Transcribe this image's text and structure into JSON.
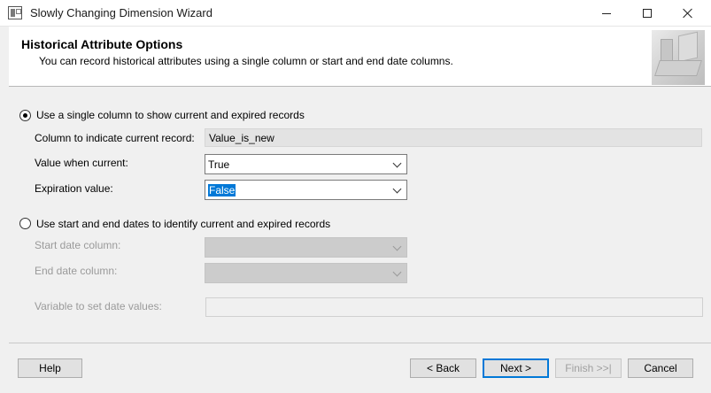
{
  "window": {
    "title": "Slowly Changing Dimension Wizard"
  },
  "header": {
    "title": "Historical Attribute Options",
    "subtitle": "You can record historical attributes using a single column or start and end date columns."
  },
  "option_single_column": {
    "label": "Use a single column to show current and expired records",
    "selected": true,
    "column_label": "Column to indicate current record:",
    "column_value": "Value_is_new",
    "current_label": "Value when current:",
    "current_value": "True",
    "expiration_label": "Expiration value:",
    "expiration_value": "False"
  },
  "option_date_range": {
    "label": "Use start and end dates to identify current and expired records",
    "selected": false,
    "start_label": "Start date column:",
    "start_value": "",
    "end_label": "End date column:",
    "end_value": "",
    "variable_label": "Variable to set date values:",
    "variable_value": ""
  },
  "buttons": {
    "help": "Help",
    "back": "< Back",
    "next": "Next >",
    "finish": "Finish >>|",
    "cancel": "Cancel"
  },
  "colors": {
    "selection_highlight": "#0078d7",
    "disabled_text": "#9a9a9a"
  },
  "icons": [
    "wizard-app-icon",
    "minimize-icon",
    "maximize-icon",
    "close-icon",
    "header-graphic",
    "chevron-down-icon"
  ]
}
